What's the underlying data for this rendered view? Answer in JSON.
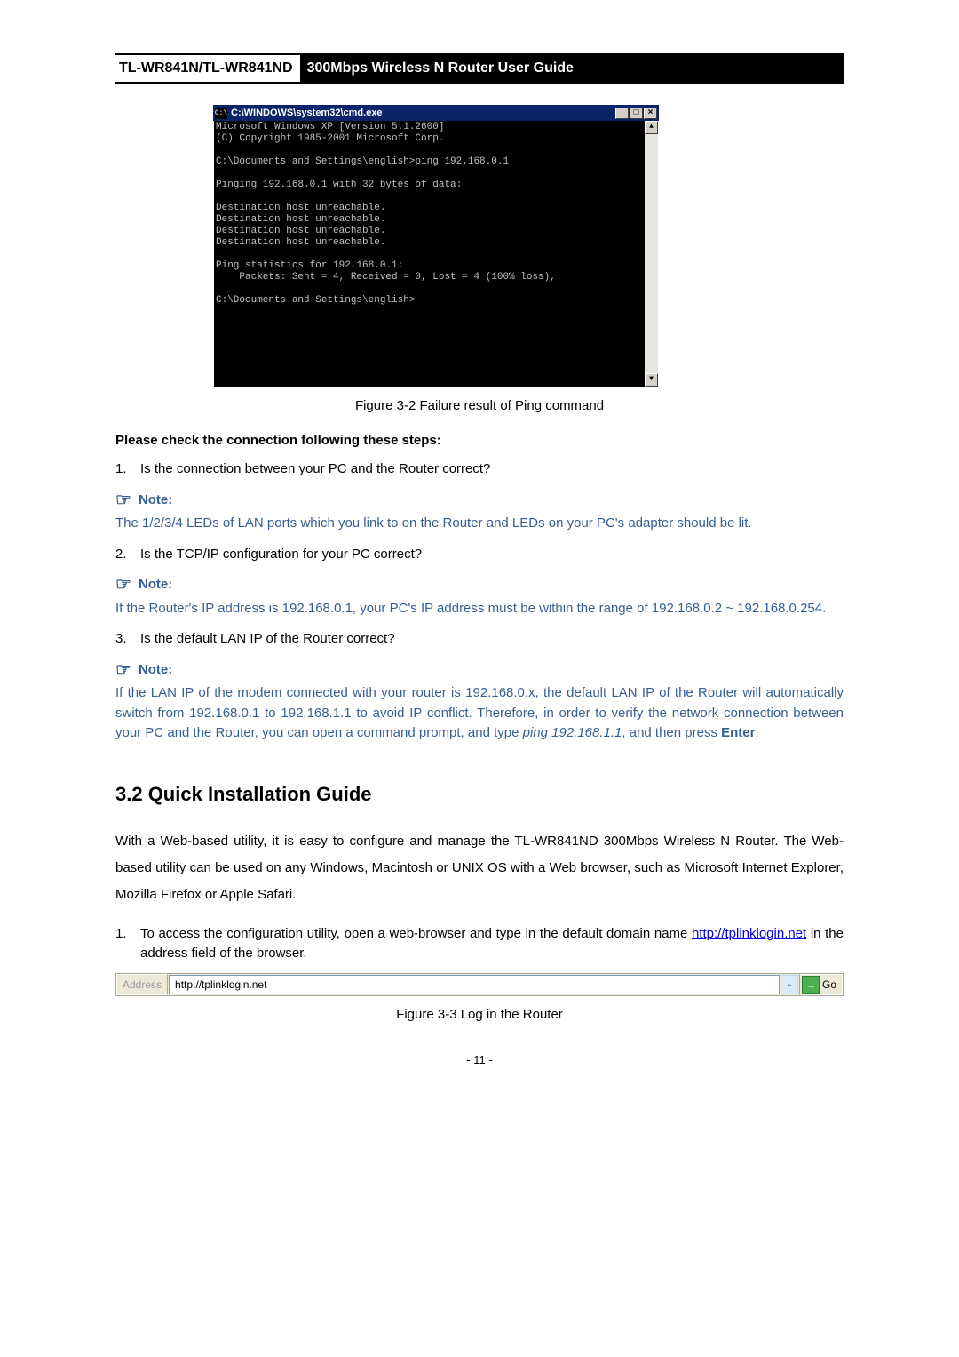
{
  "header": {
    "model": "TL-WR841N/TL-WR841ND",
    "title": "300Mbps Wireless N Router User Guide"
  },
  "cmd": {
    "icon_text": "C:\\",
    "title": "C:\\WINDOWS\\system32\\cmd.exe",
    "btn_min": "_",
    "btn_max": "□",
    "btn_close": "×",
    "scroll_up": "▲",
    "scroll_down": "▼",
    "body": "Microsoft Windows XP [Version 5.1.2600]\n(C) Copyright 1985-2001 Microsoft Corp.\n\nC:\\Documents and Settings\\english>ping 192.168.0.1\n\nPinging 192.168.0.1 with 32 bytes of data:\n\nDestination host unreachable.\nDestination host unreachable.\nDestination host unreachable.\nDestination host unreachable.\n\nPing statistics for 192.168.0.1:\n    Packets: Sent = 4, Received = 0, Lost = 4 (100% loss),\n\nC:\\Documents and Settings\\english>\n\n\n\n\n\n\n"
  },
  "fig2": "Figure 3-2    Failure result of Ping command",
  "check_heading": "Please check the connection following these steps:",
  "steps": {
    "n1": "1.",
    "t1": "Is the connection between your PC and the Router correct?",
    "n2": "2.",
    "t2": "Is the TCP/IP configuration for your PC correct?",
    "n3": "3.",
    "t3": "Is the default LAN IP of the Router correct?"
  },
  "note_label": "Note:",
  "note1": "The 1/2/3/4 LEDs of LAN ports which you link to on the Router and LEDs on your PC's adapter should be lit.",
  "note2": "If the Router's IP address is 192.168.0.1, your PC's IP address must be within the range of 192.168.0.2 ~ 192.168.0.254.",
  "note3_a": "If the LAN IP of the modem connected with your router is 192.168.0.x, the default LAN IP of the Router will automatically switch from 192.168.0.1 to 192.168.1.1 to avoid IP conflict. Therefore, in order to verify the network connection between your PC and the Router, you can open a command prompt, and type ",
  "note3_ping": "ping 192.168.1.1",
  "note3_b": ", and then press ",
  "note3_enter": "Enter",
  "note3_c": ".",
  "section_heading": "3.2  Quick Installation Guide",
  "para1": "With a Web-based utility, it is easy to configure and manage the TL-WR841ND 300Mbps Wireless N Router. The Web-based utility can be used on any Windows, Macintosh or UNIX OS with a Web browser, such as Microsoft Internet Explorer, Mozilla Firefox or Apple Safari.",
  "step_access": {
    "n": "1.",
    "a": "To access the configuration utility, open a web-browser and type in the default domain name ",
    "link": "http://tplinklogin.net",
    "b": " in the address field of the browser."
  },
  "addr": {
    "label": "Address",
    "url": "http://tplinklogin.net",
    "drop": "⌄",
    "go_arrow": "→",
    "go": "Go"
  },
  "fig3": "Figure 3-3    Log in the Router",
  "pagenum": "- 11 -",
  "note_icon": "☞"
}
